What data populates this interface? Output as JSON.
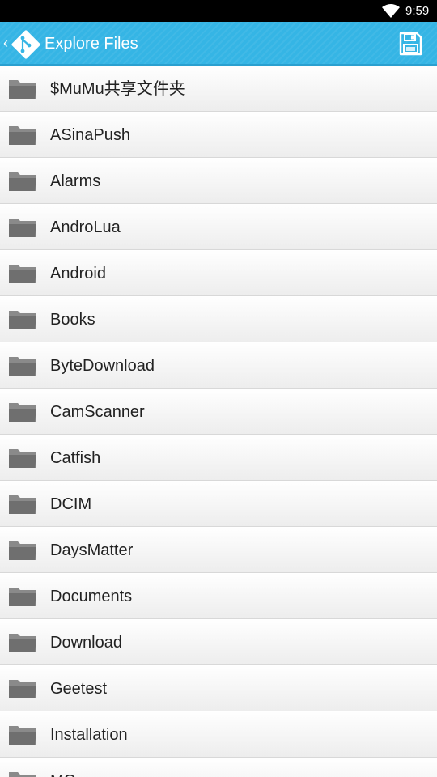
{
  "status_bar": {
    "time": "9:59"
  },
  "action_bar": {
    "title": "Explore Files",
    "save_icon": "save-icon"
  },
  "files": [
    {
      "name": "$MuMu共享文件夹"
    },
    {
      "name": "ASinaPush"
    },
    {
      "name": "Alarms"
    },
    {
      "name": "AndroLua"
    },
    {
      "name": "Android"
    },
    {
      "name": "Books"
    },
    {
      "name": "ByteDownload"
    },
    {
      "name": "CamScanner"
    },
    {
      "name": "Catfish"
    },
    {
      "name": "DCIM"
    },
    {
      "name": "DaysMatter"
    },
    {
      "name": "Documents"
    },
    {
      "name": "Download"
    },
    {
      "name": "Geetest"
    },
    {
      "name": "Installation"
    },
    {
      "name": "MQ"
    }
  ],
  "colors": {
    "accent": "#35b5e5",
    "status_bar": "#000000",
    "folder": "#7a7a7a"
  }
}
